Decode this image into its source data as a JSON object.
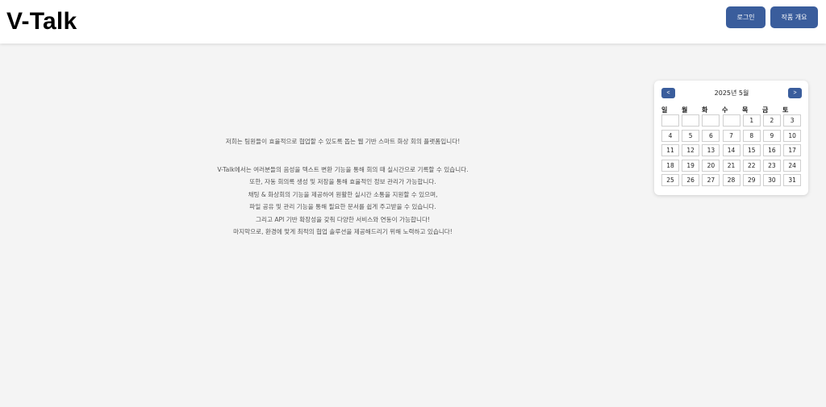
{
  "header": {
    "logo": "V-Talk",
    "login_label": "로그인",
    "overview_label": "작품 개요"
  },
  "intro": {
    "lead": "저희는 팀원들이 효율적으로 협업할 수 있도록 돕는 웹 기반 스마트 화상 회의 플랫폼입니다!",
    "lines": [
      "V-Talk에서는 여러분들의 음성을 텍스트 변환 기능을 통해 회의 때 실시간으로 기록할 수 있습니다.",
      "또한, 자동 회의록 생성 및 저장을 통해 효율적인 정보 관리가 가능합니다.",
      "채팅 & 화상회의 기능을 제공하여 원활한 실시간 소통을 지원할 수 있으며,",
      "파일 공유 및 관리 기능을 통해 필요한 문서를 쉽게 주고받을 수 있습니다.",
      "그리고 API 기반 확장성을 갖춰 다양한 서비스와 연동이 가능합니다!",
      "마지막으로, 환경에 맞게 최적의 협업 솔루션을 제공해드리기 위해 노력하고 있습니다!"
    ]
  },
  "calendar": {
    "title": "2025년 5월",
    "prev_label": "<",
    "next_label": ">",
    "weekdays": [
      "일",
      "월",
      "화",
      "수",
      "목",
      "금",
      "토"
    ],
    "days": [
      "",
      "",
      "",
      "",
      "1",
      "2",
      "3",
      "4",
      "5",
      "6",
      "7",
      "8",
      "9",
      "10",
      "11",
      "12",
      "13",
      "14",
      "15",
      "16",
      "17",
      "18",
      "19",
      "20",
      "21",
      "22",
      "23",
      "24",
      "25",
      "26",
      "27",
      "28",
      "29",
      "30",
      "31"
    ]
  },
  "colors": {
    "accent": "#3a5d9c",
    "background": "#f4f4f4",
    "text_muted": "#555555"
  }
}
